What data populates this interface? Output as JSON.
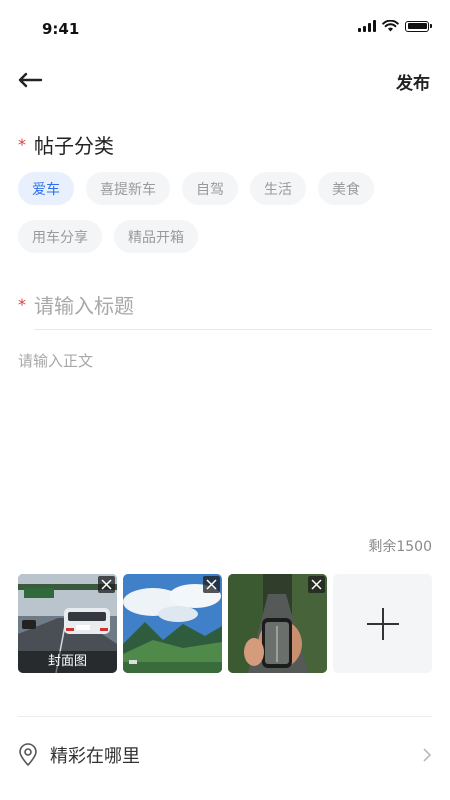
{
  "status_bar": {
    "time": "9:41"
  },
  "header": {
    "publish_label": "发布"
  },
  "category": {
    "required_mark": "*",
    "title": "帖子分类",
    "row1": [
      "爱车",
      "喜提新车",
      "自驾",
      "生活",
      "美食"
    ],
    "row2": [
      "用车分享",
      "精品开箱"
    ],
    "selected": "爱车"
  },
  "post": {
    "required_mark": "*",
    "title_placeholder": "请输入标题",
    "body_placeholder": "请输入正文",
    "remaining_label": "剩余1500"
  },
  "photos": {
    "cover_label": "封面图",
    "items": [
      "car-on-road-photo",
      "mountain-valley-photo",
      "phone-road-photo"
    ]
  },
  "location": {
    "label": "精彩在哪里"
  },
  "colors": {
    "accent": "#2f6ff0",
    "required": "#e33a3a",
    "chip_bg": "#f4f5f7"
  }
}
